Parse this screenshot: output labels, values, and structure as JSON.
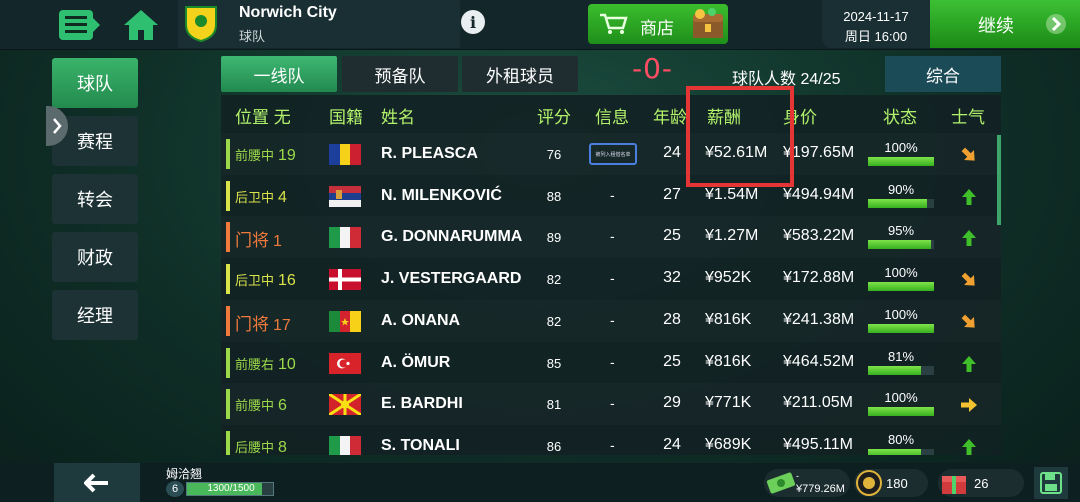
{
  "club": {
    "name": "Norwich City",
    "subtitle": "球队",
    "info_icon": "i"
  },
  "shop_label": "商店",
  "date": {
    "day": "2024-11-17",
    "weekday_time": "周日 16:00"
  },
  "continue_label": "继续",
  "sidebar": {
    "items": [
      {
        "label": "球队",
        "active": true
      },
      {
        "label": "赛程"
      },
      {
        "label": "转会"
      },
      {
        "label": "财政"
      },
      {
        "label": "经理"
      }
    ]
  },
  "tabs": [
    {
      "label": "一线队",
      "active": true
    },
    {
      "label": "预备队"
    },
    {
      "label": "外租球员"
    }
  ],
  "annotation_text": "-0-",
  "squad_count": "球队人数 24/25",
  "overall_label": "综合",
  "columns": {
    "position": "位置 无",
    "nationality": "国籍",
    "name": "姓名",
    "rating": "评分",
    "info": "信息",
    "age": "年龄",
    "wage": "薪酬",
    "value": "身价",
    "status": "状态",
    "morale": "士气"
  },
  "players": [
    {
      "pos": "前腰中",
      "num": "19",
      "pos_color": "#9bd94a",
      "flag": "romania",
      "name": "R. PLEASCA",
      "rating": "76",
      "info": "被列入租借名单",
      "age": "24",
      "wage": "¥52.61M",
      "value": "¥197.65M",
      "condition": "100%",
      "condition_pct": 100,
      "morale": "down-right"
    },
    {
      "pos": "后卫中",
      "num": "4",
      "pos_color": "#d9e34a",
      "flag": "serbia",
      "name": "N. MILENKOVIĆ",
      "rating": "88",
      "info": "-",
      "age": "27",
      "wage": "¥1.54M",
      "value": "¥494.94M",
      "condition": "90%",
      "condition_pct": 90,
      "morale": "up"
    },
    {
      "pos": "门将",
      "num": "1",
      "pos_color": "#f07a3c",
      "flag": "italy",
      "name": "G. DONNARUMMA",
      "rating": "89",
      "info": "-",
      "age": "25",
      "wage": "¥1.27M",
      "value": "¥583.22M",
      "condition": "95%",
      "condition_pct": 95,
      "morale": "up"
    },
    {
      "pos": "后卫中",
      "num": "16",
      "pos_color": "#d9e34a",
      "flag": "denmark",
      "name": "J. VESTERGAARD",
      "rating": "82",
      "info": "-",
      "age": "32",
      "wage": "¥952K",
      "value": "¥172.88M",
      "condition": "100%",
      "condition_pct": 100,
      "morale": "down-right"
    },
    {
      "pos": "门将",
      "num": "17",
      "pos_color": "#f07a3c",
      "flag": "cameroon",
      "name": "A. ONANA",
      "rating": "82",
      "info": "-",
      "age": "28",
      "wage": "¥816K",
      "value": "¥241.38M",
      "condition": "100%",
      "condition_pct": 100,
      "morale": "down-right"
    },
    {
      "pos": "前腰右",
      "num": "10",
      "pos_color": "#9bd94a",
      "flag": "turkey",
      "name": "A. ÖMUR",
      "rating": "85",
      "info": "-",
      "age": "25",
      "wage": "¥816K",
      "value": "¥464.52M",
      "condition": "81%",
      "condition_pct": 81,
      "morale": "up"
    },
    {
      "pos": "前腰中",
      "num": "6",
      "pos_color": "#9bd94a",
      "flag": "macedonia",
      "name": "E. BARDHI",
      "rating": "81",
      "info": "-",
      "age": "29",
      "wage": "¥771K",
      "value": "¥211.05M",
      "condition": "100%",
      "condition_pct": 100,
      "morale": "right"
    },
    {
      "pos": "后腰中",
      "num": "8",
      "pos_color": "#9bd94a",
      "flag": "italy",
      "name": "S. TONALI",
      "rating": "86",
      "info": "-",
      "age": "24",
      "wage": "¥689K",
      "value": "¥495.11M",
      "condition": "80%",
      "condition_pct": 80,
      "morale": "up"
    }
  ],
  "bottom": {
    "manager_name": "姆洽翘",
    "level": "6",
    "xp": "1300/1500",
    "xp_fraction": 0.867,
    "money_label": "-",
    "money": "¥779.26M",
    "coins": "180",
    "items": "26"
  },
  "colors": {
    "accent_green": "#3bbd2d",
    "header_green": "#b2f26b",
    "highlight_red": "#e63535",
    "morale_up": "#3fbf2a",
    "morale_down": "#f0a030"
  }
}
